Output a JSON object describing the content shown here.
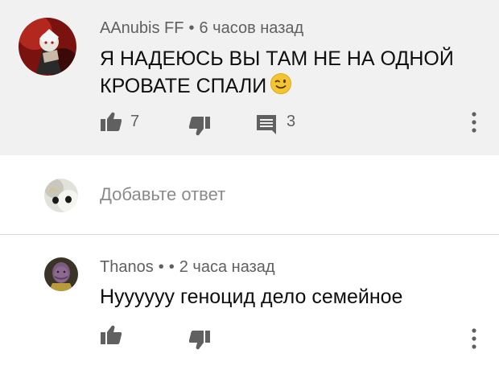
{
  "comments": [
    {
      "author": "AAnubis FF",
      "separator": "•",
      "time": "6 часов назад",
      "text_line1": "Я НАДЕЮСЬ ВЫ ТАМ НЕ НА ОДНОЙ",
      "text_line2": "КРОВАТЕ СПАЛИ",
      "emoji": "winking-smiley-icon",
      "likes": "7",
      "replies": "3"
    },
    {
      "author": "Thanos",
      "separator": "•",
      "separator2": "•",
      "time": "2 часа назад",
      "text": "Нууууyy геноцид дело семейное"
    }
  ],
  "reply": {
    "placeholder": "Добавьте ответ"
  },
  "colors": {
    "highlight_bg": "#f1f1f1",
    "meta_text": "#606060",
    "icon": "#606060",
    "emoji": "#f5c531"
  }
}
